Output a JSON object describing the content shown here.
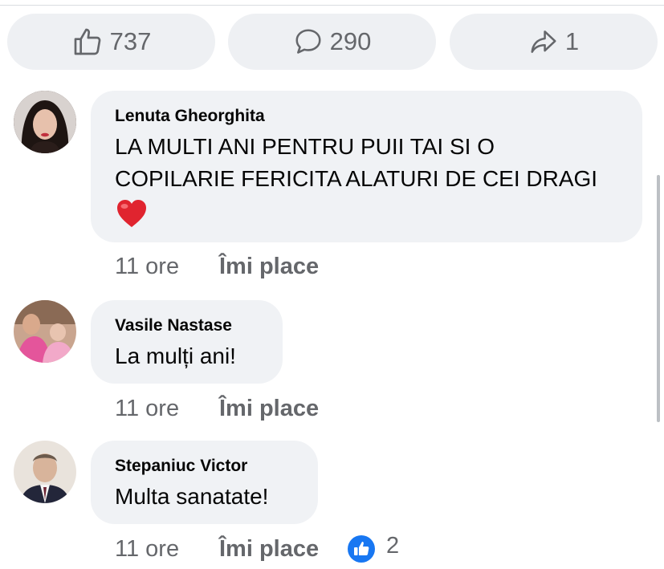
{
  "reactions_bar": {
    "likes": {
      "icon": "thumbs-up-icon",
      "count": "737"
    },
    "comments": {
      "icon": "comment-icon",
      "count": "290"
    },
    "shares": {
      "icon": "share-icon",
      "count": "1"
    }
  },
  "comments": [
    {
      "author": "Lenuta  Gheorghita",
      "text_lines": [
        "LA MULTI ANI PENTRU PUII TAI SI O",
        "COPILARIE FERICITA ALATURI DE CEI DRAGI"
      ],
      "emoji": "❤️",
      "time": "11 ore",
      "like_label": "Îmi place"
    },
    {
      "author": "Vasile Nastase",
      "text_lines": [
        "La mulți ani!"
      ],
      "time": "11 ore",
      "like_label": "Îmi place"
    },
    {
      "author": "Stepaniuc Victor",
      "text_lines": [
        "Multa sanatate!"
      ],
      "time": "11 ore",
      "like_label": "Îmi place",
      "reaction_icon": "like-reaction-icon",
      "reaction_count": "2"
    }
  ],
  "colors": {
    "pill_bg": "#eef0f3",
    "bubble_bg": "#f0f2f5",
    "muted_text": "#65676b",
    "like_blue": "#1877f2"
  }
}
